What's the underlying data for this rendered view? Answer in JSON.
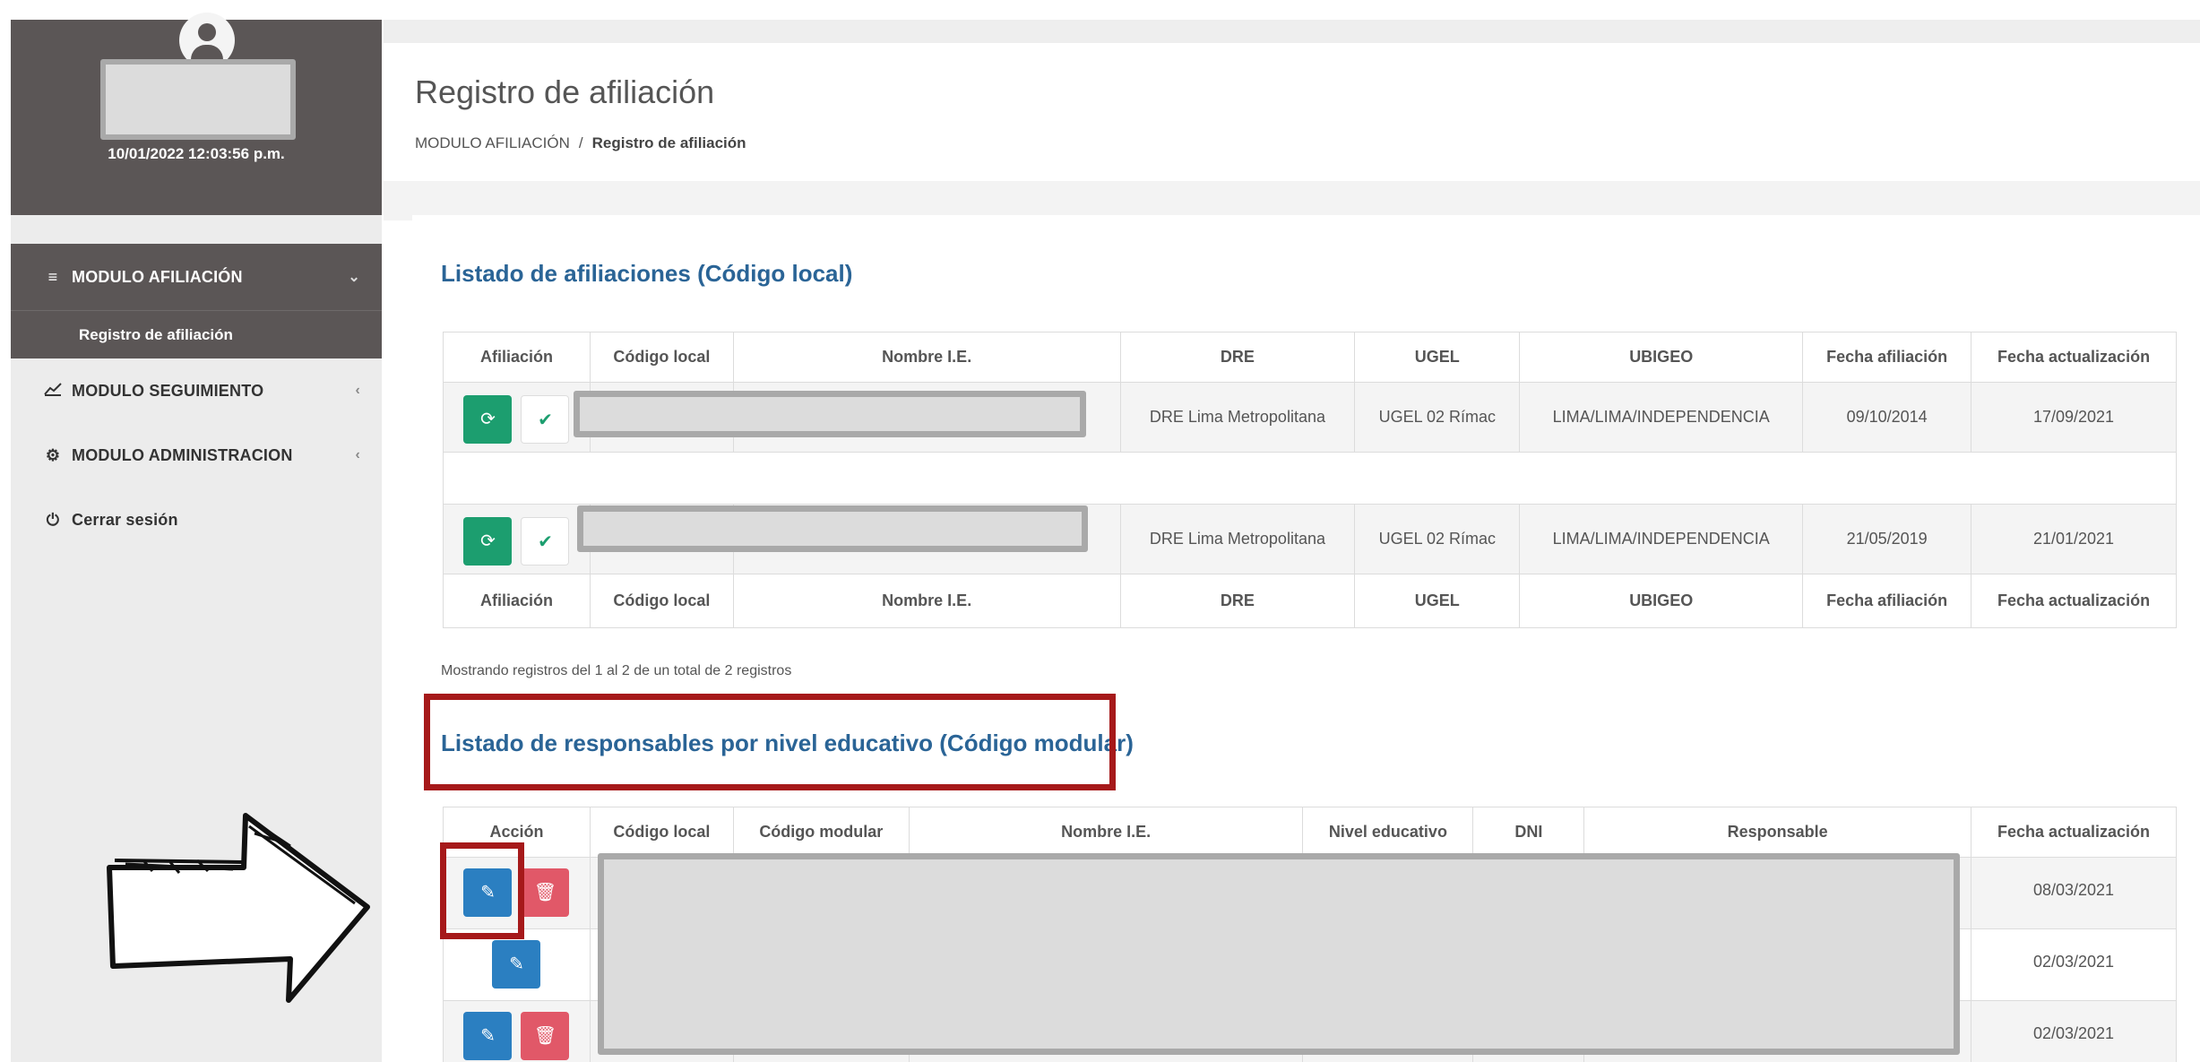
{
  "sidebar": {
    "datetime": "10/01/2022 12:03:56 p.m.",
    "menu": [
      {
        "label": "MODULO AFILIACIÓN",
        "icon": "list-icon",
        "active": true
      },
      {
        "label": "MODULO SEGUIMIENTO",
        "icon": "chart-line-icon",
        "active": false
      },
      {
        "label": "MODULO ADMINISTRACION",
        "icon": "gear-icon",
        "active": false
      },
      {
        "label": "Cerrar sesión",
        "icon": "power-icon",
        "active": false
      }
    ],
    "submenu_active": "Registro de afiliación"
  },
  "header": {
    "title": "Registro de afiliación",
    "breadcrumb": {
      "parent": "MODULO AFILIACIÓN",
      "separator": "/",
      "current": "Registro de afiliación"
    }
  },
  "afiliaciones": {
    "title": "Listado de afiliaciones (Código local)",
    "columns": [
      "Afiliación",
      "Código local",
      "Nombre I.E.",
      "DRE",
      "UGEL",
      "UBIGEO",
      "Fecha afiliación",
      "Fecha actualización"
    ],
    "rows": [
      {
        "dre": "DRE Lima Metropolitana",
        "ugel": "UGEL 02 Rímac",
        "ubigeo": "LIMA/LIMA/INDEPENDENCIA",
        "fecha_afiliacion": "09/10/2014",
        "fecha_actualizacion": "17/09/2021"
      },
      {
        "dre": "DRE Lima Metropolitana",
        "ugel": "UGEL 02 Rímac",
        "ubigeo": "LIMA/LIMA/INDEPENDENCIA",
        "fecha_afiliacion": "21/05/2019",
        "fecha_actualizacion": "21/01/2021"
      }
    ],
    "count_text": "Mostrando registros del 1 al 2 de un total de 2 registros"
  },
  "responsables": {
    "title": "Listado de responsables por nivel educativo (Código modular)",
    "columns": [
      "Acción",
      "Código local",
      "Código modular",
      "Nombre I.E.",
      "Nivel educativo",
      "DNI",
      "Responsable",
      "Fecha actualización"
    ],
    "rows": [
      {
        "fecha_actualizacion": "08/03/2021"
      },
      {
        "fecha_actualizacion": "02/03/2021"
      },
      {
        "fecha_actualizacion": "02/03/2021"
      }
    ]
  },
  "colors": {
    "sidebar_dark": "#5b5656",
    "accent_title": "#2a6496",
    "btn_green": "#1c9e6f",
    "btn_blue": "#2b7fc1",
    "btn_red": "#e15868",
    "highlight_red": "#a6191a"
  }
}
